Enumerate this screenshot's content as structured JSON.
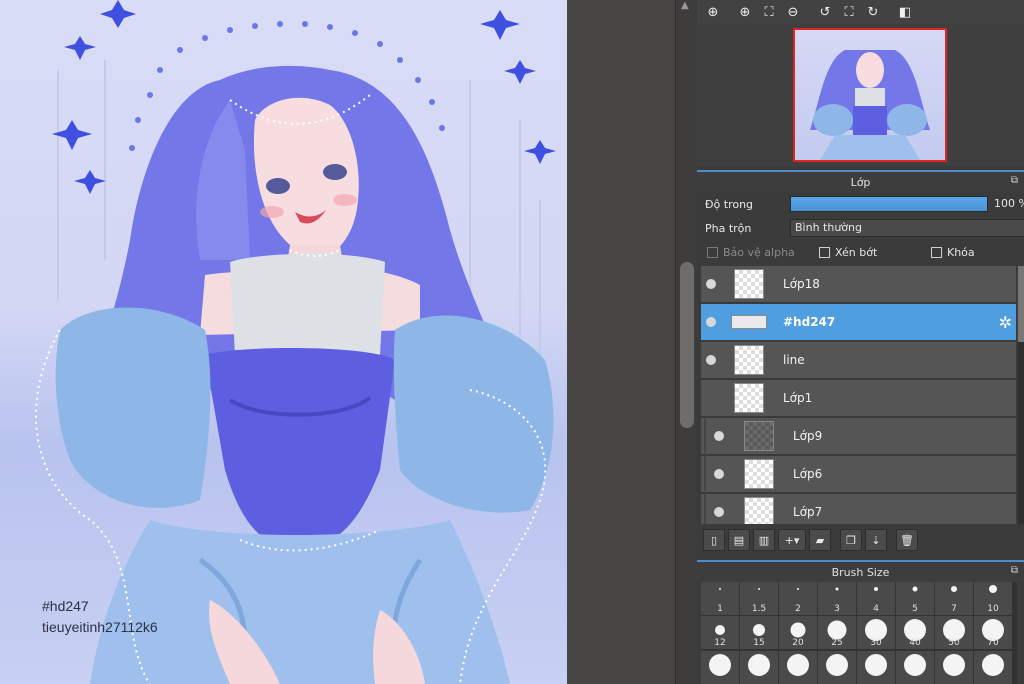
{
  "canvas": {
    "signature_line1": "#hd247",
    "signature_line2": "tieuyeitinh27112k6"
  },
  "toolbar": {
    "icons": [
      "zoom-fit-icon",
      "zoom-in-icon",
      "fit-screen-icon",
      "zoom-out-icon",
      "rotate-left-icon",
      "reset-view-icon",
      "rotate-right-icon",
      "flip-icon"
    ]
  },
  "layer_panel": {
    "title": "Lớp",
    "opacity_label": "Độ trong",
    "opacity_value": "100 %",
    "opacity_fraction": 1.0,
    "blend_label": "Pha trộn",
    "blend_value": "Bình thường",
    "protect_alpha": "Bảo vệ alpha",
    "clipping": "Xén bớt",
    "lock": "Khóa",
    "layers": [
      {
        "name": "Lớp18",
        "visible": true,
        "selected": false,
        "indent": false
      },
      {
        "name": "#hd247",
        "visible": true,
        "selected": true,
        "indent": false
      },
      {
        "name": "line",
        "visible": true,
        "selected": false,
        "indent": false
      },
      {
        "name": "Lớp1",
        "visible": false,
        "selected": false,
        "indent": false
      },
      {
        "name": "Lớp9",
        "visible": true,
        "selected": false,
        "indent": true
      },
      {
        "name": "Lớp6",
        "visible": true,
        "selected": false,
        "indent": true
      },
      {
        "name": "Lớp7",
        "visible": true,
        "selected": false,
        "indent": true
      }
    ]
  },
  "brush_panel": {
    "title": "Brush Size",
    "sizes": [
      "1",
      "1.5",
      "2",
      "3",
      "4",
      "5",
      "7",
      "10",
      "12",
      "15",
      "20",
      "25",
      "30",
      "40",
      "50",
      "70",
      "",
      "",
      "",
      "",
      "",
      "",
      "",
      ""
    ]
  }
}
